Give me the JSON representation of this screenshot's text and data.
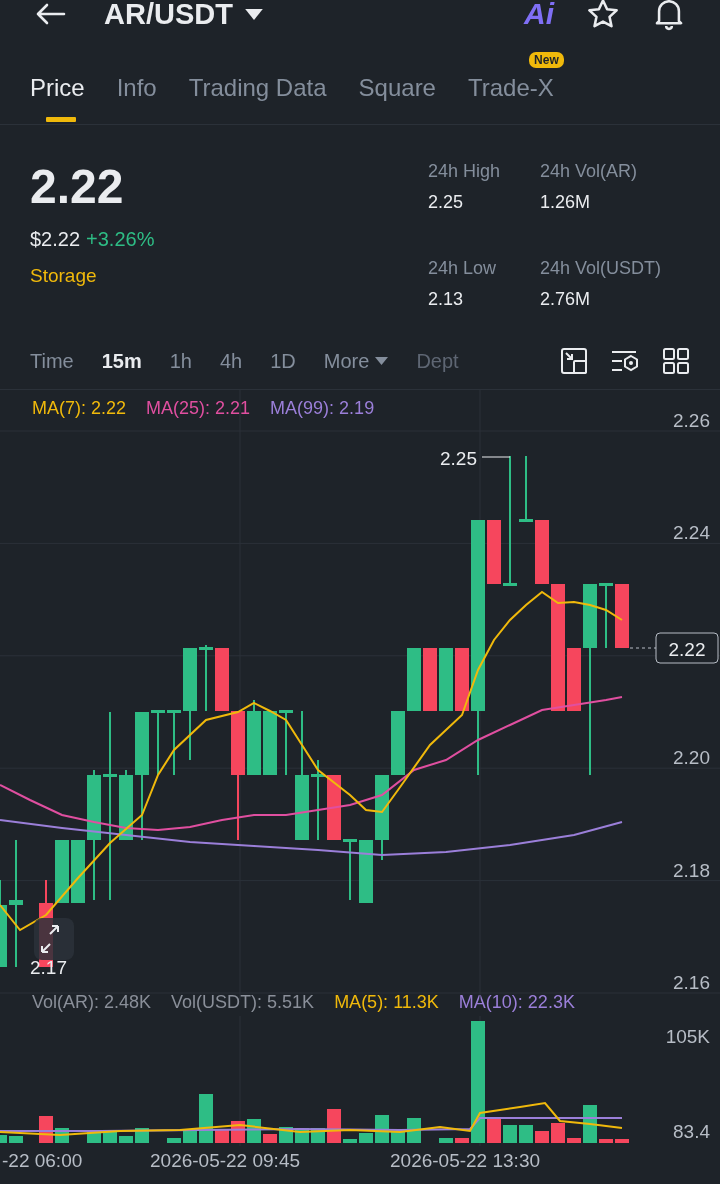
{
  "header": {
    "pair": "AR/USDT",
    "ai_label": "Ai"
  },
  "tabs": [
    {
      "label": "Price",
      "selected": true
    },
    {
      "label": "Info",
      "selected": false
    },
    {
      "label": "Trading Data",
      "selected": false
    },
    {
      "label": "Square",
      "selected": false
    },
    {
      "label": "Trade-X",
      "selected": false,
      "badge": "New"
    }
  ],
  "price": {
    "last": "2.22",
    "fiat": "$2.22",
    "change": "+3.26%",
    "tag": "Storage"
  },
  "stats": [
    {
      "label": "24h High",
      "value": "2.25"
    },
    {
      "label": "24h Vol(AR)",
      "value": "1.26M"
    },
    {
      "label": "24h Low",
      "value": "2.13"
    },
    {
      "label": "24h Vol(USDT)",
      "value": "2.76M"
    }
  ],
  "intervals": [
    {
      "label": "Time",
      "selected": false,
      "kind": "text"
    },
    {
      "label": "15m",
      "selected": true,
      "kind": "text"
    },
    {
      "label": "1h",
      "selected": false,
      "kind": "text"
    },
    {
      "label": "4h",
      "selected": false,
      "kind": "text"
    },
    {
      "label": "1D",
      "selected": false,
      "kind": "text"
    },
    {
      "label": "More",
      "selected": false,
      "kind": "dropdown"
    },
    {
      "label": "Dept",
      "selected": false,
      "kind": "faded"
    }
  ],
  "chart": {
    "ma_legend": [
      {
        "label": "MA(7): 2.22",
        "color": "#f0b90b"
      },
      {
        "label": "MA(25): 2.21",
        "color": "#e04fa0"
      },
      {
        "label": "MA(99): 2.19",
        "color": "#9b7fd9"
      }
    ],
    "price_labels": [
      "2.26",
      "2.24",
      "2.20",
      "2.18",
      "2.16"
    ],
    "current_price": "2.22",
    "high_marker": "2.25",
    "low_marker": "2.17"
  },
  "volume": {
    "legend": [
      {
        "label": "Vol(AR): 2.48K",
        "color": "#8a8f99"
      },
      {
        "label": "Vol(USDT): 5.51K",
        "color": "#8a8f99"
      },
      {
        "label": "MA(5): 11.3K",
        "color": "#f0b90b"
      },
      {
        "label": "MA(10): 22.3K",
        "color": "#9b7fd9"
      }
    ],
    "axis_labels": [
      "105K",
      "83.4"
    ]
  },
  "time_labels": [
    "-22 06:00",
    "2026-05-22 09:45",
    "2026-05-22 13:30"
  ]
}
